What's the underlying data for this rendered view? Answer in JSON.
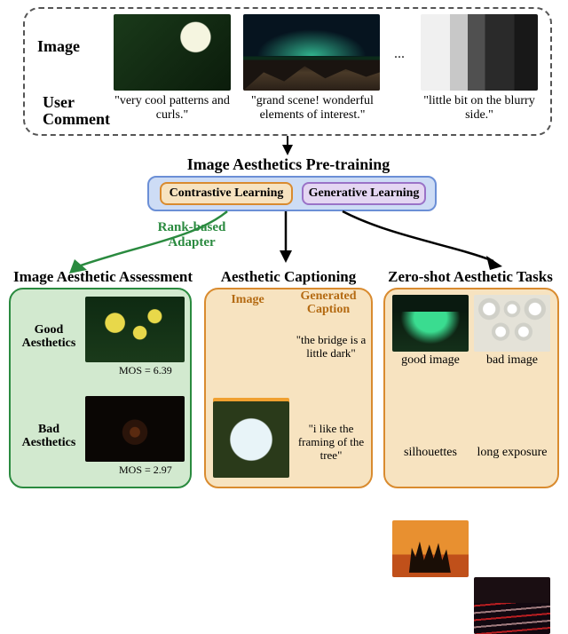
{
  "top": {
    "image_label": "Image",
    "comment_label_line1": "User",
    "comment_label_line2": "Comment",
    "ellipsis": "...",
    "pairs": [
      {
        "comment": "\"very cool patterns and curls.\""
      },
      {
        "comment": "\"grand scene! wonderful elements of interest.\""
      },
      {
        "comment": "\"little bit on the blurry side.\""
      }
    ]
  },
  "pretrain": {
    "heading": "Image Aesthetics Pre-training",
    "contrastive": "Contrastive Learning",
    "generative": "Generative Learning",
    "rank_adapter_line1": "Rank-based",
    "rank_adapter_line2": "Adapter"
  },
  "tasks": {
    "iaa": {
      "heading": "Image Aesthetic Assessment",
      "good_label": "Good\nAesthetics",
      "bad_label": "Bad\nAesthetics",
      "good_mos": "MOS = 6.39",
      "bad_mos": "MOS = 2.97"
    },
    "cap": {
      "heading": "Aesthetic Captioning",
      "col_image": "Image",
      "col_caption": "Generated\nCaption",
      "cap1": "\"the bridge is a little dark\"",
      "cap2": "\"i like the framing of the tree\""
    },
    "zs": {
      "heading": "Zero-shot Aesthetic Tasks",
      "labels": [
        "good image",
        "bad image",
        "silhouettes",
        "long exposure"
      ]
    }
  }
}
